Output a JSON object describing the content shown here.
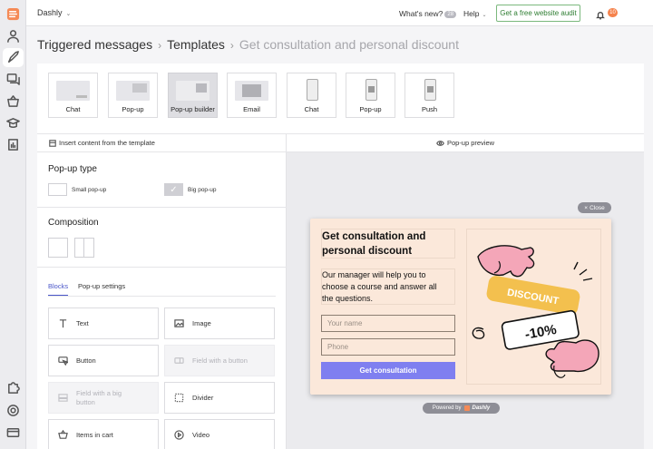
{
  "topbar": {
    "project": "Dashly",
    "whats_new": "What's new?",
    "whats_new_badge": "28",
    "help": "Help",
    "audit_button": "Get a free website audit",
    "notifications_count": "10"
  },
  "breadcrumb": {
    "items": [
      "Triggered messages",
      "Templates",
      "Get consultation and personal discount"
    ]
  },
  "channels": [
    {
      "label": "Chat"
    },
    {
      "label": "Pop-up"
    },
    {
      "label": "Pop-up builder"
    },
    {
      "label": "Email"
    },
    {
      "label": "Chat"
    },
    {
      "label": "Pop-up"
    },
    {
      "label": "Push"
    }
  ],
  "editor": {
    "insert_template": "Insert content from the template",
    "popup_type_title": "Pop-up type",
    "small_popup": "Small pop-up",
    "big_popup": "Big pop-up",
    "composition_title": "Composition",
    "tabs": [
      "Blocks",
      "Pop-up settings"
    ],
    "blocks": [
      {
        "label": "Text",
        "icon": "text-icon"
      },
      {
        "label": "Image",
        "icon": "image-icon"
      },
      {
        "label": "Button",
        "icon": "button-icon"
      },
      {
        "label": "Field with a button",
        "icon": "field-button-icon"
      },
      {
        "label": "Field with a big button",
        "icon": "field-big-button-icon"
      },
      {
        "label": "Divider",
        "icon": "divider-icon"
      },
      {
        "label": "Items in cart",
        "icon": "cart-icon"
      },
      {
        "label": "Video",
        "icon": "video-icon"
      }
    ]
  },
  "preview": {
    "header": "Pop-up preview",
    "close": "Close",
    "title_line1": "Get consultation and",
    "title_line2": "personal discount",
    "desc_line1": "Our manager will help you to",
    "desc_line2": "choose a course and answer all",
    "desc_line3": "the questions.",
    "name_placeholder": "Your name",
    "phone_placeholder": "Phone",
    "submit": "Get consultation",
    "art_discount": "DISCOUNT",
    "art_percent": "-10%",
    "powered_by": "Powered by",
    "powered_brand": "Dashly"
  },
  "colors": {
    "accent": "#4a56c9",
    "popup_bg": "#fbe8da",
    "popup_button": "#7f7ff0",
    "audit_green": "#2e7d32"
  }
}
